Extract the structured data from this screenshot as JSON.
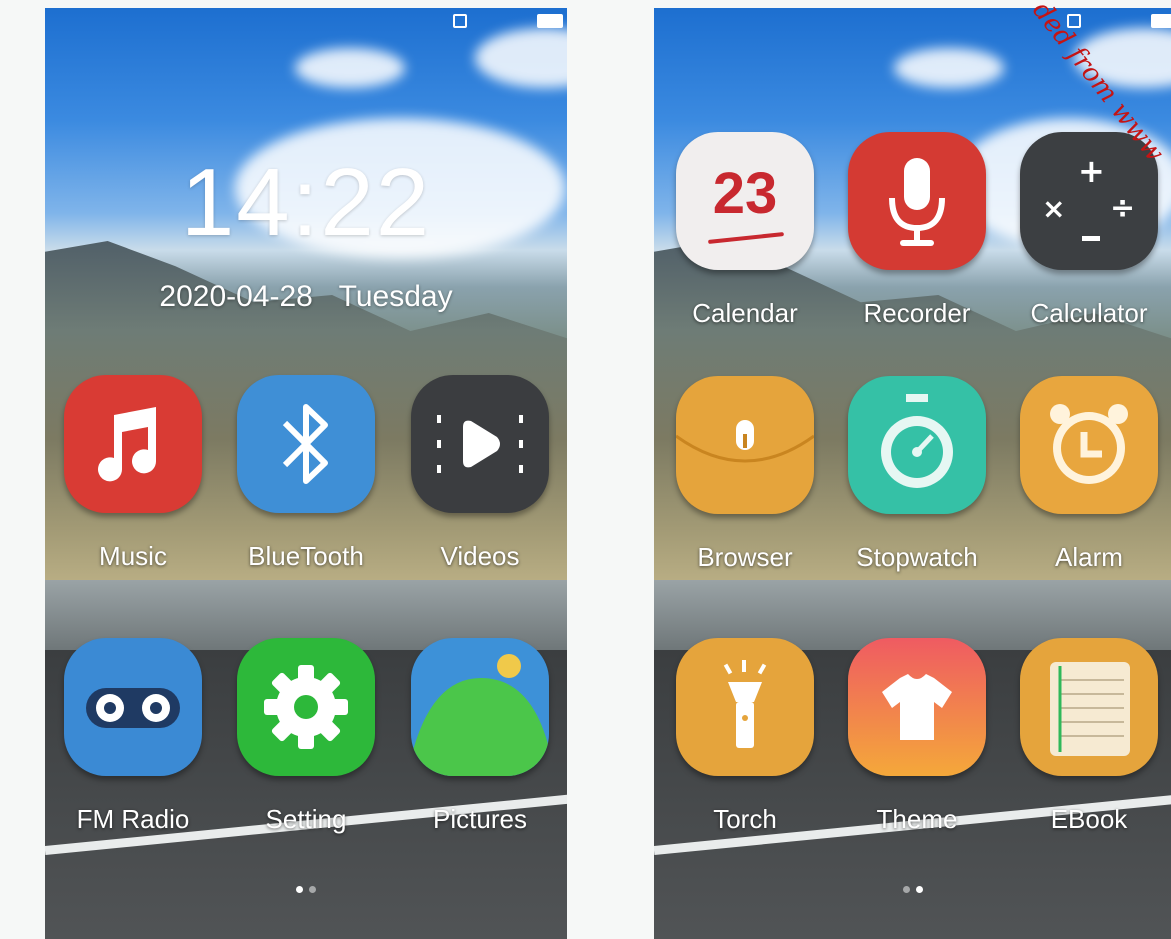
{
  "left_screen": {
    "time": "14:22",
    "date": "2020-04-28",
    "weekday": "Tuesday",
    "apps": [
      {
        "label": "Music",
        "icon": "music-note-icon",
        "color": "#d93b34"
      },
      {
        "label": "BlueTooth",
        "icon": "bluetooth-icon",
        "color": "#3f8fd6"
      },
      {
        "label": "Videos",
        "icon": "video-play-icon",
        "color": "#3b3d40"
      },
      {
        "label": "FM Radio",
        "icon": "radio-icon",
        "color": "#3b8ad4"
      },
      {
        "label": "Setting",
        "icon": "gear-icon",
        "color": "#2db83a"
      },
      {
        "label": "Pictures",
        "icon": "picture-icon",
        "color": "#3d91d8"
      }
    ]
  },
  "right_screen": {
    "apps": [
      {
        "label": "Calendar",
        "icon": "calendar-icon",
        "color": "#f1eeee",
        "badge": "23"
      },
      {
        "label": "Recorder",
        "icon": "microphone-icon",
        "color": "#d43a33"
      },
      {
        "label": "Calculator",
        "icon": "calculator-icon",
        "color": "#3c3f42"
      },
      {
        "label": "Browser",
        "icon": "browser-icon",
        "color": "#e5a43c"
      },
      {
        "label": "Stopwatch",
        "icon": "stopwatch-icon",
        "color": "#35c1a6"
      },
      {
        "label": "Alarm",
        "icon": "alarm-clock-icon",
        "color": "#e8a63e"
      },
      {
        "label": "Torch",
        "icon": "torch-icon",
        "color": "#e5a43c"
      },
      {
        "label": "Theme",
        "icon": "tshirt-icon",
        "color": "#ef6d57"
      },
      {
        "label": "EBook",
        "icon": "ebook-icon",
        "color": "#e5a43c"
      }
    ]
  },
  "watermark": "ded from www"
}
